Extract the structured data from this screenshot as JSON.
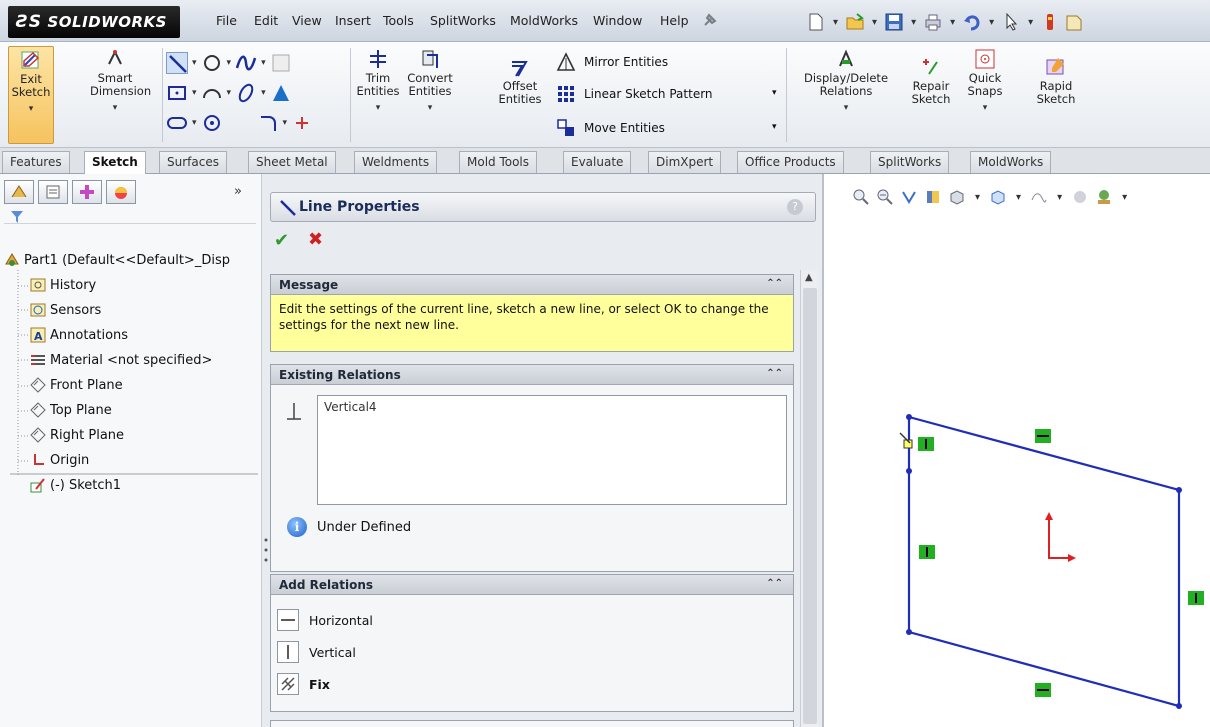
{
  "app": {
    "logo_ds": "ƧS",
    "logo_text": "SOLIDWORKS"
  },
  "menu": [
    "File",
    "Edit",
    "View",
    "Insert",
    "Tools",
    "SplitWorks",
    "MoldWorks",
    "Window",
    "Help"
  ],
  "ribbon": {
    "exit_sketch": "Exit Sketch",
    "smart_dimension": "Smart Dimension",
    "trim_entities": "Trim Entities",
    "convert_entities": "Convert Entities",
    "offset_entities": "Offset Entities",
    "mirror_entities": "Mirror Entities",
    "linear_sketch_pattern": "Linear Sketch Pattern",
    "move_entities": "Move Entities",
    "display_delete_relations": "Display/Delete Relations",
    "repair_sketch": "Repair Sketch",
    "quick_snaps": "Quick Snaps",
    "rapid_sketch": "Rapid Sketch"
  },
  "tabs": [
    "Features",
    "Sketch",
    "Surfaces",
    "Sheet Metal",
    "Weldments",
    "Mold Tools",
    "Evaluate",
    "DimXpert",
    "Office Products",
    "SplitWorks",
    "MoldWorks"
  ],
  "active_tab": "Sketch",
  "tree": {
    "collapse": "»",
    "root": "Part1  (Default<<Default>_Disp",
    "items": [
      "History",
      "Sensors",
      "Annotations",
      "Material <not specified>",
      "Front Plane",
      "Top Plane",
      "Right Plane",
      "Origin",
      "(-) Sketch1"
    ]
  },
  "pm": {
    "title": "Line Properties",
    "help": "?",
    "ok": "✔",
    "cancel": "✖",
    "message_head": "Message",
    "message_text": "Edit the settings of the current line, sketch a new line, or select OK to change the settings for the next new line.",
    "existing_head": "Existing Relations",
    "existing_item": "Vertical4",
    "status": "Under Defined",
    "add_head": "Add Relations",
    "add_items": [
      "Horizontal",
      "Vertical",
      "Fix"
    ]
  },
  "colors": {
    "sketch_line": "#1f2db8",
    "relation_marker": "#22b022",
    "origin_red": "#e02020",
    "message_bg": "#ffff9c"
  }
}
